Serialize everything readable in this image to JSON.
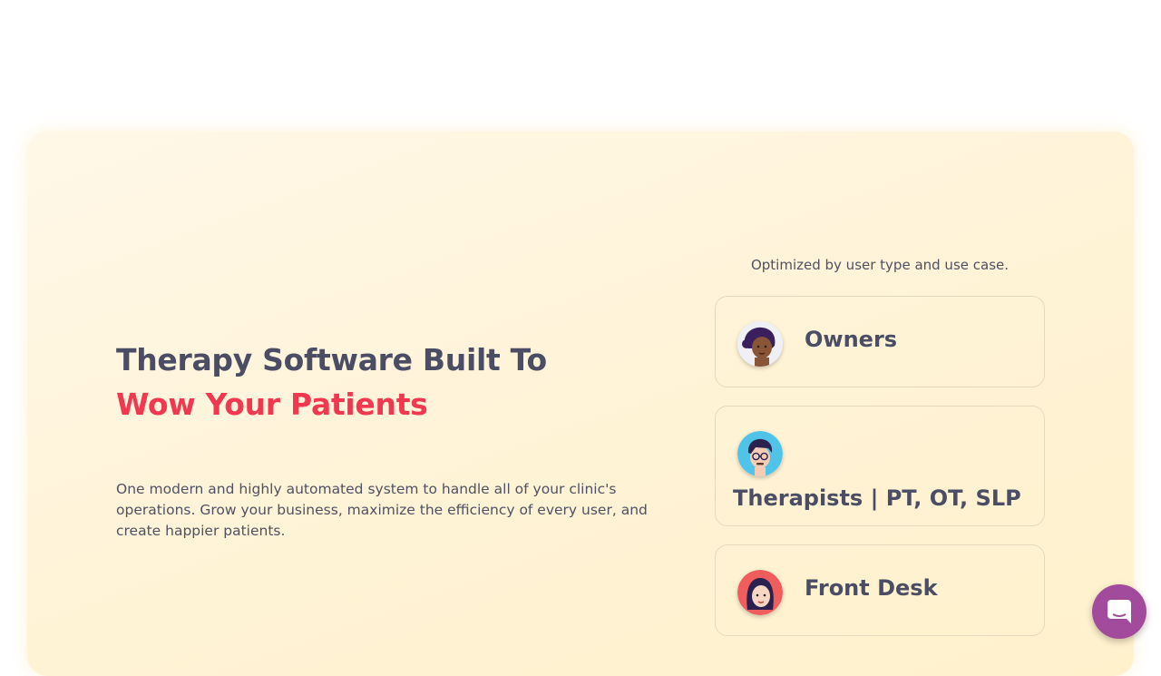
{
  "hero": {
    "headline_line1": "Therapy Software Built To",
    "headline_line2": "Wow Your Patients",
    "description": "One modern and highly automated system to handle all of your clinic's operations. Grow your business, maximize the efficiency of every user, and create happier patients.",
    "optimized_caption": "Optimized by user type and use case."
  },
  "user_types": [
    {
      "label": "Owners",
      "icon": "owner-avatar-icon"
    },
    {
      "label": "Therapists | PT, OT, SLP",
      "icon": "therapist-avatar-icon"
    },
    {
      "label": "Front Desk",
      "icon": "front-desk-avatar-icon"
    }
  ],
  "chat": {
    "icon": "chat-bubble-icon"
  },
  "colors": {
    "accent": "#f2384f",
    "heading": "#4a4d63",
    "hero_background": "#fff3d6",
    "chat_button": "#a24b9c"
  }
}
